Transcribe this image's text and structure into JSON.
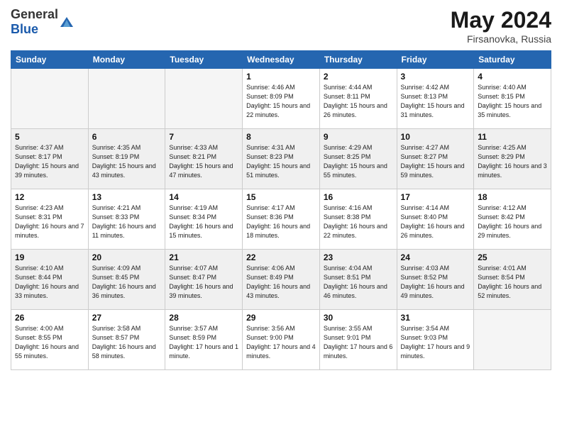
{
  "logo": {
    "general": "General",
    "blue": "Blue"
  },
  "title": {
    "month": "May 2024",
    "location": "Firsanovka, Russia"
  },
  "headers": [
    "Sunday",
    "Monday",
    "Tuesday",
    "Wednesday",
    "Thursday",
    "Friday",
    "Saturday"
  ],
  "weeks": [
    [
      {
        "date": "",
        "info": ""
      },
      {
        "date": "",
        "info": ""
      },
      {
        "date": "",
        "info": ""
      },
      {
        "date": "1",
        "info": "Sunrise: 4:46 AM\nSunset: 8:09 PM\nDaylight: 15 hours\nand 22 minutes."
      },
      {
        "date": "2",
        "info": "Sunrise: 4:44 AM\nSunset: 8:11 PM\nDaylight: 15 hours\nand 26 minutes."
      },
      {
        "date": "3",
        "info": "Sunrise: 4:42 AM\nSunset: 8:13 PM\nDaylight: 15 hours\nand 31 minutes."
      },
      {
        "date": "4",
        "info": "Sunrise: 4:40 AM\nSunset: 8:15 PM\nDaylight: 15 hours\nand 35 minutes."
      }
    ],
    [
      {
        "date": "5",
        "info": "Sunrise: 4:37 AM\nSunset: 8:17 PM\nDaylight: 15 hours\nand 39 minutes."
      },
      {
        "date": "6",
        "info": "Sunrise: 4:35 AM\nSunset: 8:19 PM\nDaylight: 15 hours\nand 43 minutes."
      },
      {
        "date": "7",
        "info": "Sunrise: 4:33 AM\nSunset: 8:21 PM\nDaylight: 15 hours\nand 47 minutes."
      },
      {
        "date": "8",
        "info": "Sunrise: 4:31 AM\nSunset: 8:23 PM\nDaylight: 15 hours\nand 51 minutes."
      },
      {
        "date": "9",
        "info": "Sunrise: 4:29 AM\nSunset: 8:25 PM\nDaylight: 15 hours\nand 55 minutes."
      },
      {
        "date": "10",
        "info": "Sunrise: 4:27 AM\nSunset: 8:27 PM\nDaylight: 15 hours\nand 59 minutes."
      },
      {
        "date": "11",
        "info": "Sunrise: 4:25 AM\nSunset: 8:29 PM\nDaylight: 16 hours\nand 3 minutes."
      }
    ],
    [
      {
        "date": "12",
        "info": "Sunrise: 4:23 AM\nSunset: 8:31 PM\nDaylight: 16 hours\nand 7 minutes."
      },
      {
        "date": "13",
        "info": "Sunrise: 4:21 AM\nSunset: 8:33 PM\nDaylight: 16 hours\nand 11 minutes."
      },
      {
        "date": "14",
        "info": "Sunrise: 4:19 AM\nSunset: 8:34 PM\nDaylight: 16 hours\nand 15 minutes."
      },
      {
        "date": "15",
        "info": "Sunrise: 4:17 AM\nSunset: 8:36 PM\nDaylight: 16 hours\nand 18 minutes."
      },
      {
        "date": "16",
        "info": "Sunrise: 4:16 AM\nSunset: 8:38 PM\nDaylight: 16 hours\nand 22 minutes."
      },
      {
        "date": "17",
        "info": "Sunrise: 4:14 AM\nSunset: 8:40 PM\nDaylight: 16 hours\nand 26 minutes."
      },
      {
        "date": "18",
        "info": "Sunrise: 4:12 AM\nSunset: 8:42 PM\nDaylight: 16 hours\nand 29 minutes."
      }
    ],
    [
      {
        "date": "19",
        "info": "Sunrise: 4:10 AM\nSunset: 8:44 PM\nDaylight: 16 hours\nand 33 minutes."
      },
      {
        "date": "20",
        "info": "Sunrise: 4:09 AM\nSunset: 8:45 PM\nDaylight: 16 hours\nand 36 minutes."
      },
      {
        "date": "21",
        "info": "Sunrise: 4:07 AM\nSunset: 8:47 PM\nDaylight: 16 hours\nand 39 minutes."
      },
      {
        "date": "22",
        "info": "Sunrise: 4:06 AM\nSunset: 8:49 PM\nDaylight: 16 hours\nand 43 minutes."
      },
      {
        "date": "23",
        "info": "Sunrise: 4:04 AM\nSunset: 8:51 PM\nDaylight: 16 hours\nand 46 minutes."
      },
      {
        "date": "24",
        "info": "Sunrise: 4:03 AM\nSunset: 8:52 PM\nDaylight: 16 hours\nand 49 minutes."
      },
      {
        "date": "25",
        "info": "Sunrise: 4:01 AM\nSunset: 8:54 PM\nDaylight: 16 hours\nand 52 minutes."
      }
    ],
    [
      {
        "date": "26",
        "info": "Sunrise: 4:00 AM\nSunset: 8:55 PM\nDaylight: 16 hours\nand 55 minutes."
      },
      {
        "date": "27",
        "info": "Sunrise: 3:58 AM\nSunset: 8:57 PM\nDaylight: 16 hours\nand 58 minutes."
      },
      {
        "date": "28",
        "info": "Sunrise: 3:57 AM\nSunset: 8:59 PM\nDaylight: 17 hours\nand 1 minute."
      },
      {
        "date": "29",
        "info": "Sunrise: 3:56 AM\nSunset: 9:00 PM\nDaylight: 17 hours\nand 4 minutes."
      },
      {
        "date": "30",
        "info": "Sunrise: 3:55 AM\nSunset: 9:01 PM\nDaylight: 17 hours\nand 6 minutes."
      },
      {
        "date": "31",
        "info": "Sunrise: 3:54 AM\nSunset: 9:03 PM\nDaylight: 17 hours\nand 9 minutes."
      },
      {
        "date": "",
        "info": ""
      }
    ]
  ]
}
